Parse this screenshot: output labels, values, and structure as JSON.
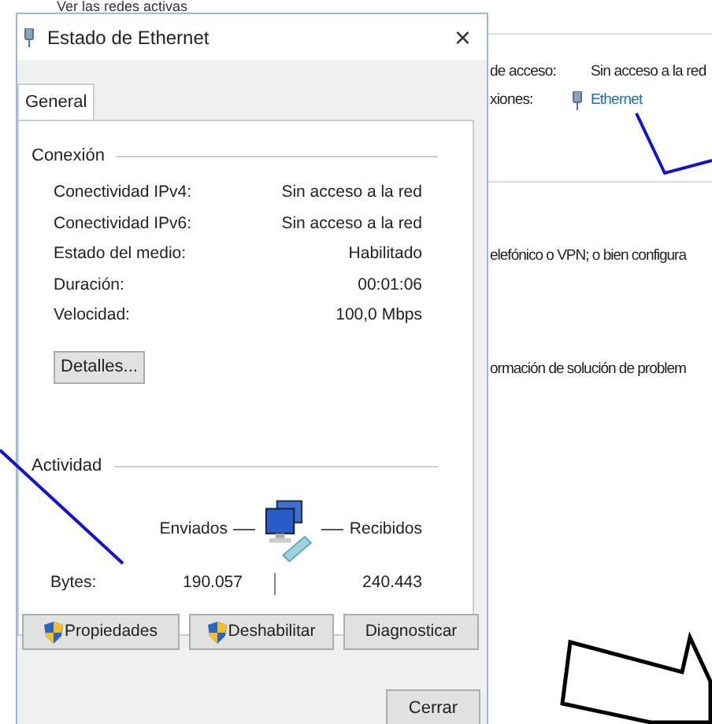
{
  "background": {
    "heading": "Ver las redes activas",
    "access_label": "de acceso:",
    "access_value": "Sin acceso a la red",
    "connections_label": "xiones:",
    "connection_link": "Ethernet",
    "text_1": "elefónico o VPN; o bien configura",
    "text_2": "ormación de solución de problem"
  },
  "dialog": {
    "title": "Estado de Ethernet",
    "close": "×",
    "tabs": [
      {
        "label": "General",
        "selected": true
      }
    ],
    "connection": {
      "heading": "Conexión",
      "rows": [
        {
          "label": "Conectividad IPv4:",
          "value": "Sin acceso a la red"
        },
        {
          "label": "Conectividad IPv6:",
          "value": "Sin acceso a la red"
        },
        {
          "label": "Estado del medio:",
          "value": "Habilitado"
        },
        {
          "label": "Duración:",
          "value": "00:01:06"
        },
        {
          "label": "Velocidad:",
          "value": "100,0 Mbps"
        }
      ],
      "details_button": "Detalles..."
    },
    "activity": {
      "heading": "Actividad",
      "sent_label": "Enviados",
      "received_label": "Recibidos",
      "bytes_label": "Bytes:",
      "sent": "190.057",
      "received": "240.443"
    },
    "buttons": [
      {
        "label": "Propiedades",
        "shield": true
      },
      {
        "label": "Deshabilitar",
        "shield": true
      },
      {
        "label": "Diagnosticar",
        "shield": false
      }
    ],
    "close_button": "Cerrar"
  }
}
